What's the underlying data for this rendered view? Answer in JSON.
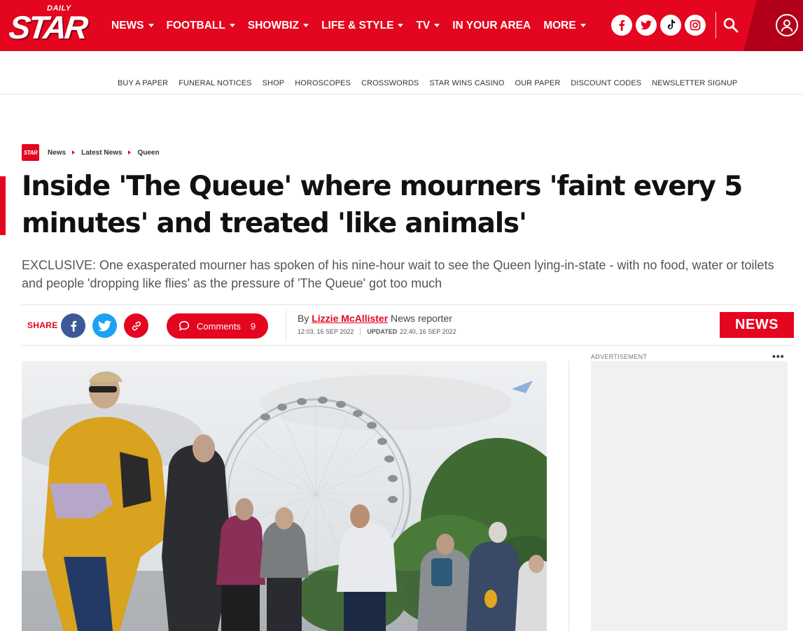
{
  "header": {
    "logo_small": "DAILY",
    "logo_main": "STAR",
    "nav": [
      {
        "label": "NEWS",
        "dropdown": true
      },
      {
        "label": "FOOTBALL",
        "dropdown": true
      },
      {
        "label": "SHOWBIZ",
        "dropdown": true
      },
      {
        "label": "LIFE & STYLE",
        "dropdown": true
      },
      {
        "label": "TV",
        "dropdown": true
      },
      {
        "label": "IN YOUR AREA",
        "dropdown": false
      },
      {
        "label": "MORE",
        "dropdown": true
      }
    ],
    "social_icons": [
      "facebook-icon",
      "twitter-icon",
      "tiktok-icon",
      "instagram-icon"
    ],
    "search_icon": "search-icon",
    "account_icon": "account-icon",
    "brand_color": "#e4051f"
  },
  "subnav": {
    "items": [
      "BUY A PAPER",
      "FUNERAL NOTICES",
      "SHOP",
      "HOROSCOPES",
      "CROSSWORDS",
      "STAR WINS CASINO",
      "OUR PAPER",
      "DISCOUNT CODES",
      "NEWSLETTER SIGNUP"
    ]
  },
  "breadcrumb": {
    "logo": "STAR",
    "items": [
      "News",
      "Latest News",
      "Queen"
    ]
  },
  "article": {
    "headline": "Inside 'The Queue' where mourners 'faint every 5 minutes' and treated 'like animals'",
    "standfirst": "EXCLUSIVE: One exasperated mourner has spoken of his nine-hour wait to see the Queen lying-in-state - with no food, water or toilets and people 'dropping like flies' as the pressure of 'The Queue' got too much",
    "share_label": "SHARE",
    "comments_label": "Comments",
    "comments_count": "9",
    "byline_prefix": "By",
    "author": "Lizzie McAllister",
    "author_role": "News reporter",
    "published": "12:03, 16 SEP 2022",
    "updated_label": "UPDATED",
    "updated": "22:40, 16 SEP 2022",
    "section_badge": "NEWS"
  },
  "sidebar": {
    "ad_label": "ADVERTISEMENT",
    "menu_icon": "more-dots-icon"
  }
}
